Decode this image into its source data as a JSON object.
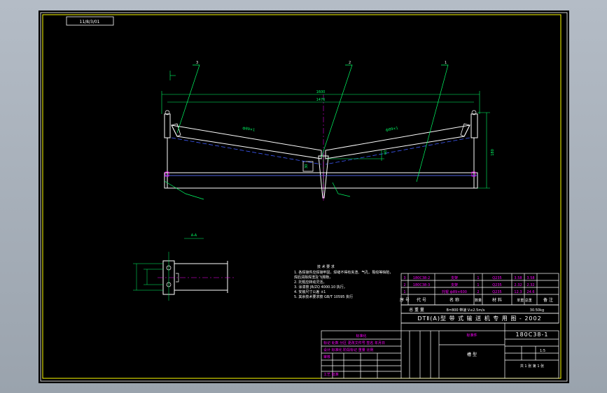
{
  "drawing": {
    "corner_tag": "11/8/3/01",
    "section_label": "A-A",
    "callouts": [
      "3",
      "2",
      "1"
    ],
    "dimensions": {
      "overall_length": "1600",
      "inner_length": "1476",
      "left_roller": "ф89×1",
      "right_roller": "ф89×1",
      "height": "180",
      "depth": "30",
      "mid_offset": "60"
    },
    "notes": {
      "heading": "技 术 要 求",
      "lines": [
        "1. 各焊接件应焊接牢固，焊缝不得有夹渣、气孔、裂纹等缺陷，",
        "焊后清除焊渣及飞溅物，",
        "2. 托辊应转动灵活，",
        "3. 涂漆按 JB/ZQ 4000.10 执行，",
        "4. 安装尺寸公差 ±1",
        "5. 其余技术要求按 GB/T 10595 执行"
      ]
    }
  },
  "title_block": {
    "parts": [
      {
        "no": "3",
        "code": "180C38-2",
        "name": "支架",
        "qty": "1",
        "material": "Q235",
        "unit_weight": "3.58",
        "total_weight": "3.58"
      },
      {
        "no": "2",
        "code": "180C38-3",
        "name": "支架",
        "qty": "1",
        "material": "Q235",
        "unit_weight": "2.32",
        "total_weight": "2.32"
      },
      {
        "no": "1",
        "code": "",
        "name": "托辊 ф89×600",
        "qty": "2",
        "material": "Q235",
        "unit_weight": "12.3",
        "total_weight": "24.6"
      }
    ],
    "header": {
      "no": "序 号",
      "code": "代 号",
      "name": "名 称",
      "qty": "数量",
      "material": "材 料",
      "weight": "单重 总重",
      "remark": "备 注"
    },
    "weight_row": {
      "label": "总 重 量",
      "value": "30.50kg",
      "spec": "B=800  带速 V≤2.5m/s"
    },
    "series": "DTⅡ(A)型 带 式 输 送 机 专 用 图 - 2002",
    "drawing_no": "180C38-1",
    "center_label": "标准件",
    "drawing_name": "槽 型",
    "scale": "1:5",
    "sheet_info": "共 1 张 第 1 张",
    "revision_table": {
      "heading": "标准化",
      "rows": [
        "标记 处数 分区 更改文件号 签名 年月日",
        "设计  标准化  阶段标记  重量  比例",
        "审核",
        "工艺  批准"
      ]
    }
  }
}
